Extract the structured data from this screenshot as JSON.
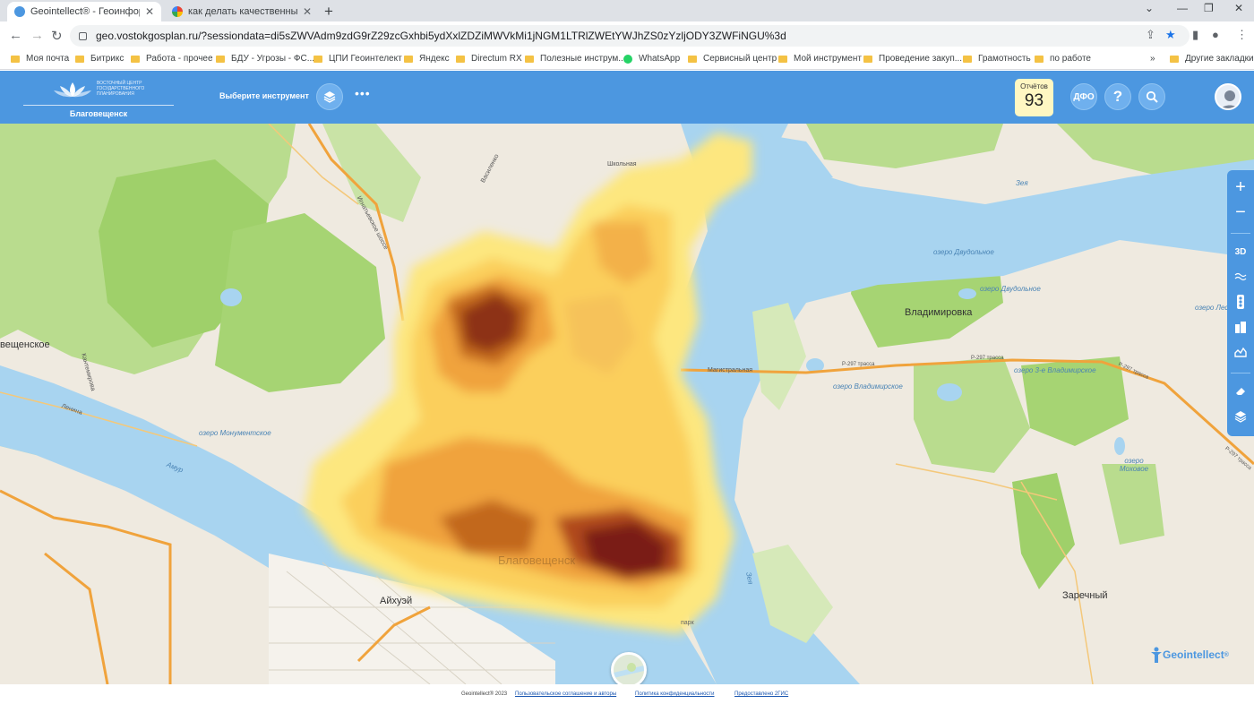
{
  "browser": {
    "tabs": [
      {
        "title": "Geointellect® - Геоинформаци...",
        "active": true
      },
      {
        "title": "как делать качественные снимк...",
        "active": false
      }
    ],
    "url": "geo.vostokgosplan.ru/?sessiondata=di5sZWVAdm9zdG9rZ29zcGxhbi5ydXxlZDZiMWVkMi1jNGM1LTRlZWEtYWJhZS0zYzljODY3ZWFiNGU%3d",
    "bookmarks": [
      "Моя почта",
      "Битрикс",
      "Работа - прочее",
      "БДУ - Угрозы - ФС...",
      "ЦПИ Геоинтелект",
      "Яндекс",
      "Directum RX",
      "Полезные инструм...",
      "WhatsApp",
      "Сервисный центр",
      "Мой инструмент",
      "Проведение закуп...",
      "Грамотность",
      "по работе"
    ],
    "other_bookmarks": "Другие закладки",
    "overflow": "»"
  },
  "app": {
    "org_lines": [
      "ВОСТОЧНЫЙ ЦЕНТР",
      "ГОСУДАРСТВЕННОГО",
      "ПЛАНИРОВАНИЯ"
    ],
    "city": "Благовещенск",
    "tool_select": "Выберите инструмент",
    "more": "•••",
    "reports_label": "Отчётов",
    "reports_count": "93",
    "dfo_label": "ДФО",
    "help_label": "?",
    "brand": "Geointellect",
    "brand_reg": "®",
    "colors": {
      "bar": "#4c97e0",
      "heat_outer": "#fde77f",
      "heat_core": "#7a1f15"
    }
  },
  "map_labels": {
    "towns": [
      "Владимировка",
      "Заречный",
      "Айхуэй",
      "вещенское"
    ],
    "roads": [
      "Игнатьевское шоссе",
      "Василенко",
      "Школьная",
      "Магистральная",
      "Ленина",
      "Кантемирова",
      "Р-297 трасса",
      "Р-297 трасса",
      "Р-297 трасса",
      "Р-297 трасса"
    ],
    "rivers": [
      "Амур",
      "Зея",
      "Зея"
    ],
    "lakes": [
      "озеро Двудольное",
      "озеро Двудольное",
      "озеро Лес",
      "озеро Владимирское",
      "озеро 3-е Владимирское",
      "озеро Моховое",
      "озеро Монументское"
    ],
    "other": [
      "Благовещенск",
      "парк"
    ]
  },
  "right_tools": [
    "zoom-in",
    "zoom-out",
    "3D",
    "wave",
    "traffic",
    "building",
    "chart-area",
    "eraser",
    "layers"
  ],
  "right_tool_labels": {
    "zoom_in": "+",
    "zoom_out": "−",
    "three_d": "3D"
  },
  "footer": {
    "copyright": "Geointellect® 2023",
    "terms": "Пользовательское соглашение и авторы",
    "privacy": "Политика конфиденциальности",
    "provided": "Предоставлено 2ГИС"
  }
}
